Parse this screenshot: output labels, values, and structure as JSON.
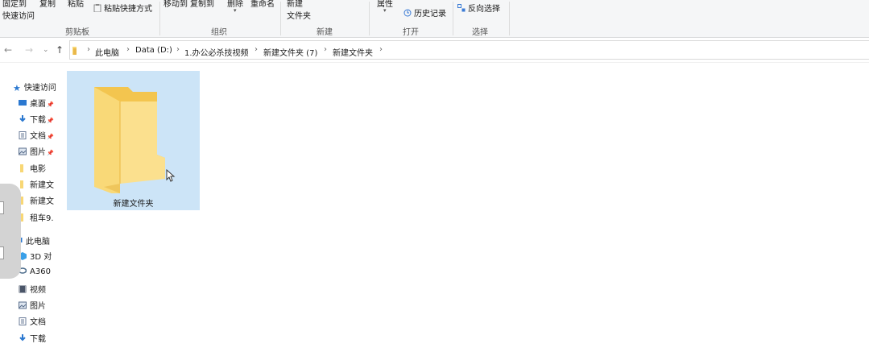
{
  "ribbon": {
    "pin_line1": "固定到",
    "pin_line2": "快速访问",
    "copy": "复制",
    "paste": "粘贴",
    "paste_shortcut": "粘贴快捷方式",
    "move_to": "移动到",
    "copy_to": "复制到",
    "delete": "删除",
    "rename": "重命名",
    "new": "新建",
    "new_folder": "文件夹",
    "properties": "属性",
    "history": "历史记录",
    "invert_select": "反向选择",
    "groups": {
      "clipboard": "剪贴板",
      "organize": "组织",
      "new": "新建",
      "open": "打开",
      "select": "选择"
    }
  },
  "breadcrumb": [
    "此电脑",
    "Data (D:)",
    "1.办公必杀技视频",
    "新建文件夹 (7)",
    "新建文件夹"
  ],
  "sidebar": {
    "quick_access": "快速访问",
    "items": [
      {
        "label": "桌面",
        "icon": "desktop-icon",
        "pinned": true
      },
      {
        "label": "下载",
        "icon": "download-icon",
        "pinned": true
      },
      {
        "label": "文档",
        "icon": "document-icon",
        "pinned": true
      },
      {
        "label": "图片",
        "icon": "picture-icon",
        "pinned": true
      },
      {
        "label": "电影",
        "icon": "folder-icon",
        "pinned": false
      },
      {
        "label": "新建文",
        "icon": "folder-icon",
        "pinned": false
      },
      {
        "label": "新建文",
        "icon": "folder-icon",
        "pinned": false
      },
      {
        "label": "租车9.",
        "icon": "folder-icon",
        "pinned": false
      }
    ],
    "this_pc": "此电脑",
    "pc_items": [
      {
        "label": "3D 对",
        "icon": "3d-objects-icon"
      },
      {
        "label": "A360",
        "icon": "a360-icon"
      },
      {
        "label": "视频",
        "icon": "video-icon"
      },
      {
        "label": "图片",
        "icon": "picture-icon"
      },
      {
        "label": "文档",
        "icon": "document-icon"
      },
      {
        "label": "下载",
        "icon": "download-icon"
      }
    ]
  },
  "content": {
    "folder_name": "新建文件夹"
  },
  "colors": {
    "selection": "#cce4f7",
    "folder": "#f8d775",
    "accent": "#0078d7"
  }
}
